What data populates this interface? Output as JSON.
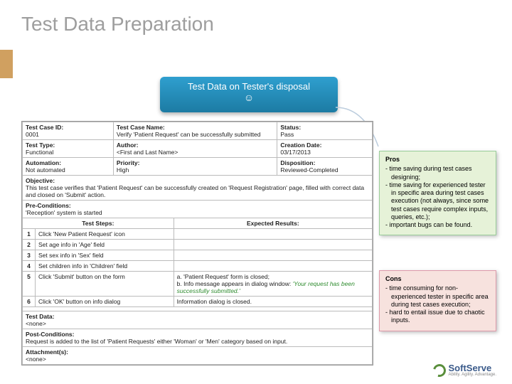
{
  "title": "Test Data Preparation",
  "banner": {
    "line1": "Test Data on Tester's disposal",
    "emoji": "☺"
  },
  "tc": {
    "id_lbl": "Test Case ID:",
    "id_val": "0001",
    "name_lbl": "Test Case Name:",
    "name_val": "Verify 'Patient Request' can be successfully submitted",
    "status_lbl": "Status:",
    "status_val": "Pass",
    "type_lbl": "Test Type:",
    "type_val": "Functional",
    "author_lbl": "Author:",
    "author_val": "<First and Last Name>",
    "cdate_lbl": "Creation Date:",
    "cdate_val": "03/17/2013",
    "auto_lbl": "Automation:",
    "auto_val": "Not automated",
    "prio_lbl": "Priority:",
    "prio_val": "High",
    "disp_lbl": "Disposition:",
    "disp_val": "Reviewed-Completed",
    "obj_lbl": "Objective:",
    "obj_val": "This test case verifies that 'Patient Request' can be successfully created on 'Request Registration' page, filled with correct data and closed on 'Submit' action.",
    "pre_lbl": "Pre-Conditions:",
    "pre_val": "'Reception' system is started",
    "steps_hdr": "Test Steps:",
    "exp_hdr": "Expected Results:",
    "steps": [
      {
        "n": "1",
        "s": "Click 'New Patient Request' icon",
        "e": ""
      },
      {
        "n": "2",
        "s": "Set age info in 'Age' field",
        "e": ""
      },
      {
        "n": "3",
        "s": "Set sex info in 'Sex' field",
        "e": ""
      },
      {
        "n": "4",
        "s": "Set children info in 'Children' field",
        "e": ""
      },
      {
        "n": "5",
        "s": "Click 'Submit' button on the form",
        "e_a": "a.   'Patient Request' form is closed;",
        "e_b_pre": "b.   Info message appears in dialog window: ",
        "e_b_msg": "'Your request has been successfully submitted.'"
      },
      {
        "n": "6",
        "s": "Click 'OK' button on info dialog",
        "e": "Information dialog is closed."
      }
    ],
    "td_lbl": "Test Data:",
    "td_val": "<none>",
    "post_lbl": "Post-Conditions:",
    "post_val": "Request is added to the list of 'Patient Requests' either 'Woman' or 'Men' category based on input.",
    "att_lbl": "Attachment(s):",
    "att_val": "<none>"
  },
  "pros": {
    "hd": "Pros",
    "items": [
      "time saving during test cases designing;",
      "time saving for experienced tester in specific area during test cases execution (not always, since some test cases require complex inputs, queries, etc.);",
      "important bugs can be found."
    ]
  },
  "cons": {
    "hd": "Cons",
    "items": [
      "time consuming for non-experienced tester in specific area during test cases execution;",
      "hard to entail issue due to chaotic inputs."
    ]
  },
  "logo": {
    "name": "SoftServe",
    "tag": "Ability. Agility. Advantage."
  }
}
